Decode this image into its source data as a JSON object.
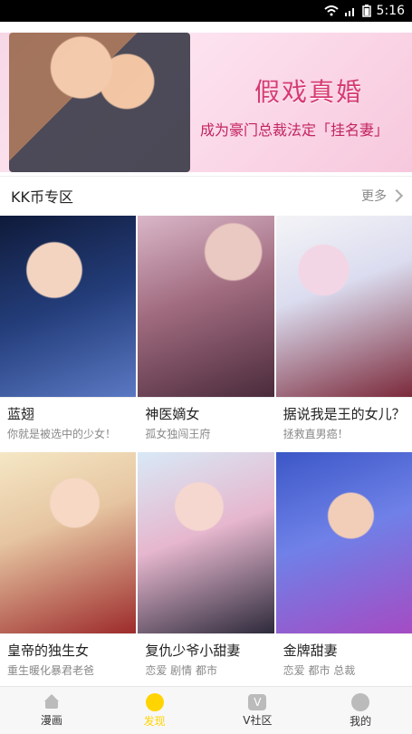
{
  "status": {
    "time": "5:16"
  },
  "banner": {
    "title": "假戏真婚",
    "subtitle": "成为豪门总裁法定「挂名妻」"
  },
  "section": {
    "title": "KK币专区",
    "more": "更多"
  },
  "comics": [
    {
      "name": "蓝翅",
      "desc": "你就是被选中的少女！"
    },
    {
      "name": "神医嫡女",
      "desc": "孤女独闯王府"
    },
    {
      "name": "据说我是王的女儿？",
      "desc": "拯救直男癌！"
    },
    {
      "name": "皇帝的独生女",
      "desc": "重生暖化暴君老爸"
    },
    {
      "name": "复仇少爷小甜妻",
      "desc": "恋爱 剧情 都市"
    },
    {
      "name": "金牌甜妻",
      "desc": "恋爱 都市 总裁"
    }
  ],
  "tabs": [
    {
      "label": "漫画"
    },
    {
      "label": "发现",
      "active": true
    },
    {
      "label": "V社区"
    },
    {
      "label": "我的"
    }
  ]
}
